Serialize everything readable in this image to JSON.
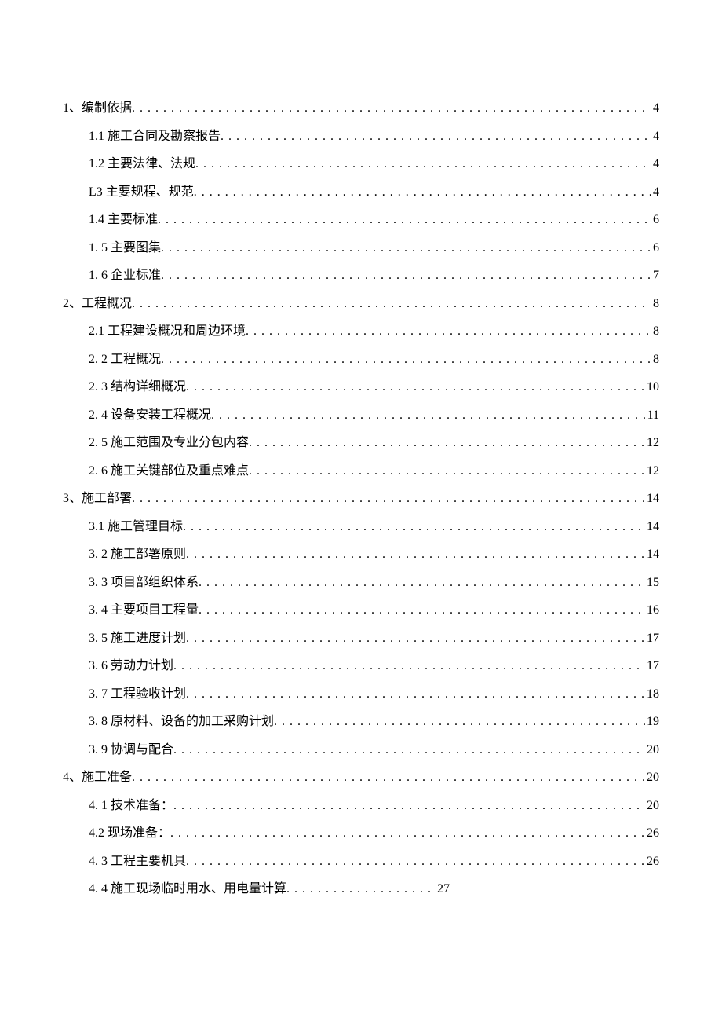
{
  "toc": [
    {
      "level": 1,
      "label": "1、编制依据",
      "page": "4"
    },
    {
      "level": 2,
      "label": "1.1 施工合同及勘察报告",
      "page": "4"
    },
    {
      "level": 2,
      "label": "1.2 主要法律、法规",
      "page": "4"
    },
    {
      "level": 2,
      "label": "L3 主要规程、规范",
      "page": "4"
    },
    {
      "level": 2,
      "label": "1.4 主要标准",
      "page": "6"
    },
    {
      "level": 2,
      "label": "1. 5 主要图集",
      "page": "6"
    },
    {
      "level": 2,
      "label": "1.  6 企业标准",
      "page": "7"
    },
    {
      "level": 1,
      "label": "2、工程概况",
      "page": "8"
    },
    {
      "level": 2,
      "label": "2.1 工程建设概况和周边环境",
      "page": "8"
    },
    {
      "level": 2,
      "label": "2.  2 工程概况",
      "page": "8"
    },
    {
      "level": 2,
      "label": "2.  3 结构详细概况",
      "page": "10"
    },
    {
      "level": 2,
      "label": "2.  4 设备安装工程概况",
      "page": "11"
    },
    {
      "level": 2,
      "label": "2.  5 施工范围及专业分包内容",
      "page": "12"
    },
    {
      "level": 2,
      "label": "2.  6 施工关键部位及重点难点",
      "page": "12"
    },
    {
      "level": 1,
      "label": "3、施工部署",
      "page": "14"
    },
    {
      "level": 2,
      "label": "3.1 施工管理目标",
      "page": "14"
    },
    {
      "level": 2,
      "label": "3.  2 施工部署原则",
      "page": "14"
    },
    {
      "level": 2,
      "label": "3.  3 项目部组织体系",
      "page": "15"
    },
    {
      "level": 2,
      "label": "3.  4 主要项目工程量",
      "page": "16"
    },
    {
      "level": 2,
      "label": "3.  5 施工进度计划",
      "page": "17"
    },
    {
      "level": 2,
      "label": "3.  6 劳动力计划",
      "page": "17"
    },
    {
      "level": 2,
      "label": "3.  7 工程验收计划",
      "page": "18"
    },
    {
      "level": 2,
      "label": "3.  8 原材料、设备的加工采购计划",
      "page": "19"
    },
    {
      "level": 2,
      "label": "3.  9 协调与配合",
      "page": "20"
    },
    {
      "level": 1,
      "label": "4、施工准备",
      "page": "20"
    },
    {
      "level": 2,
      "label": "4.  1 技术准备：",
      "page": "20"
    },
    {
      "level": 2,
      "label": "4.2 现场准备：",
      "page": "26"
    },
    {
      "level": 2,
      "label": "4.  3 工程主要机具",
      "page": "26"
    },
    {
      "level": 2,
      "label": "4.  4 施工现场临时用水、用电量计算",
      "page": "27",
      "short": true
    }
  ]
}
